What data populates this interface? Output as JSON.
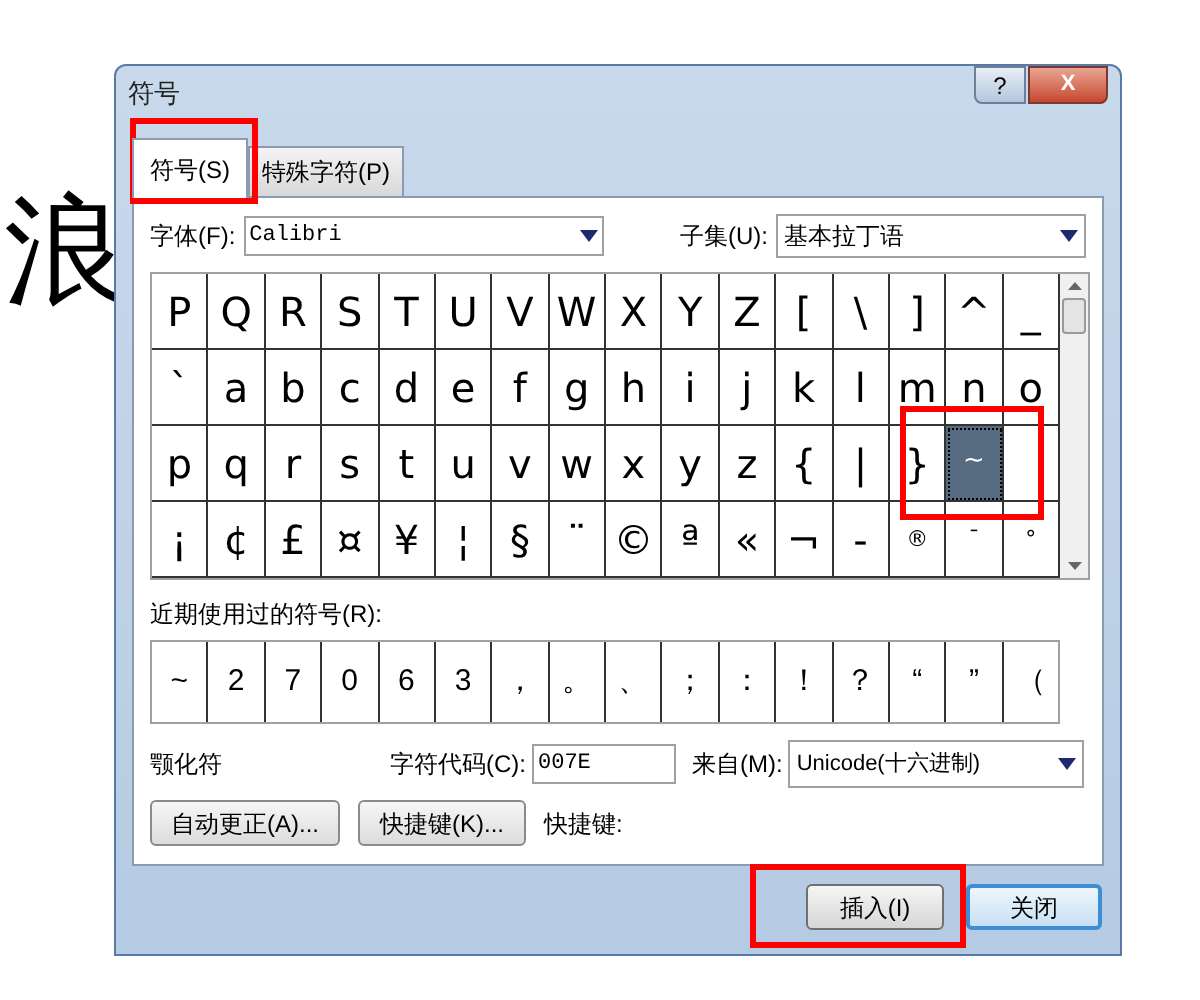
{
  "background_text": "浪",
  "window": {
    "title": "符号",
    "help": "?",
    "close": "X"
  },
  "tabs": [
    {
      "label": "符号(S)",
      "selected": true
    },
    {
      "label": "特殊字符(P)",
      "selected": false
    }
  ],
  "font": {
    "label": "字体(F):",
    "value": "Calibri"
  },
  "subset": {
    "label": "子集(U):",
    "value": "基本拉丁语"
  },
  "symbols": [
    {
      "char": "P",
      "selected": false
    },
    {
      "char": "Q",
      "selected": false
    },
    {
      "char": "R",
      "selected": false
    },
    {
      "char": "S",
      "selected": false
    },
    {
      "char": "T",
      "selected": false
    },
    {
      "char": "U",
      "selected": false
    },
    {
      "char": "V",
      "selected": false
    },
    {
      "char": "W",
      "selected": false
    },
    {
      "char": "X",
      "selected": false
    },
    {
      "char": "Y",
      "selected": false
    },
    {
      "char": "Z",
      "selected": false
    },
    {
      "char": "[",
      "selected": false
    },
    {
      "char": "\\",
      "selected": false
    },
    {
      "char": "]",
      "selected": false
    },
    {
      "char": "^",
      "selected": false
    },
    {
      "char": "_",
      "selected": false
    },
    {
      "char": "`",
      "selected": false
    },
    {
      "char": "a",
      "selected": false
    },
    {
      "char": "b",
      "selected": false
    },
    {
      "char": "c",
      "selected": false
    },
    {
      "char": "d",
      "selected": false
    },
    {
      "char": "e",
      "selected": false
    },
    {
      "char": "f",
      "selected": false
    },
    {
      "char": "g",
      "selected": false
    },
    {
      "char": "h",
      "selected": false
    },
    {
      "char": "i",
      "selected": false
    },
    {
      "char": "j",
      "selected": false
    },
    {
      "char": "k",
      "selected": false
    },
    {
      "char": "l",
      "selected": false
    },
    {
      "char": "m",
      "selected": false
    },
    {
      "char": "n",
      "selected": false
    },
    {
      "char": "o",
      "selected": false
    },
    {
      "char": "p",
      "selected": false
    },
    {
      "char": "q",
      "selected": false
    },
    {
      "char": "r",
      "selected": false
    },
    {
      "char": "s",
      "selected": false
    },
    {
      "char": "t",
      "selected": false
    },
    {
      "char": "u",
      "selected": false
    },
    {
      "char": "v",
      "selected": false
    },
    {
      "char": "w",
      "selected": false
    },
    {
      "char": "x",
      "selected": false
    },
    {
      "char": "y",
      "selected": false
    },
    {
      "char": "z",
      "selected": false
    },
    {
      "char": "{",
      "selected": false
    },
    {
      "char": "|",
      "selected": false
    },
    {
      "char": "}",
      "selected": false
    },
    {
      "char": "~",
      "selected": true
    },
    {
      "selected": false
    },
    {
      "char": "¡",
      "selected": false
    },
    {
      "char": "¢",
      "selected": false
    },
    {
      "char": "£",
      "selected": false
    },
    {
      "char": "¤",
      "selected": false
    },
    {
      "char": "¥",
      "selected": false
    },
    {
      "char": "¦",
      "selected": false
    },
    {
      "char": "§",
      "selected": false
    },
    {
      "char": "¨",
      "selected": false
    },
    {
      "char": "©",
      "selected": false
    },
    {
      "char": "ª",
      "selected": false
    },
    {
      "char": "«",
      "selected": false
    },
    {
      "char": "¬",
      "selected": false
    },
    {
      "char": "-",
      "selected": false
    },
    {
      "char": "®",
      "selected": false
    },
    {
      "char": "¯",
      "selected": false
    },
    {
      "char": "°",
      "selected": false
    }
  ],
  "recent": {
    "label": "近期使用过的符号(R):",
    "symbols": [
      "~",
      "2",
      "7",
      "0",
      "6",
      "3",
      "，",
      "。",
      "、",
      "；",
      "：",
      "！",
      "？",
      "“",
      "”",
      "（"
    ]
  },
  "char_name": "颚化符",
  "char_code": {
    "label": "字符代码(C):",
    "value": "007E"
  },
  "from": {
    "label": "来自(M):",
    "value": "Unicode(十六进制)"
  },
  "autocorrect_button": "自动更正(A)...",
  "shortcut_button": "快捷键(K)...",
  "shortcut_label": "快捷键:",
  "insert_button": "插入(I)",
  "close_button": "关闭"
}
